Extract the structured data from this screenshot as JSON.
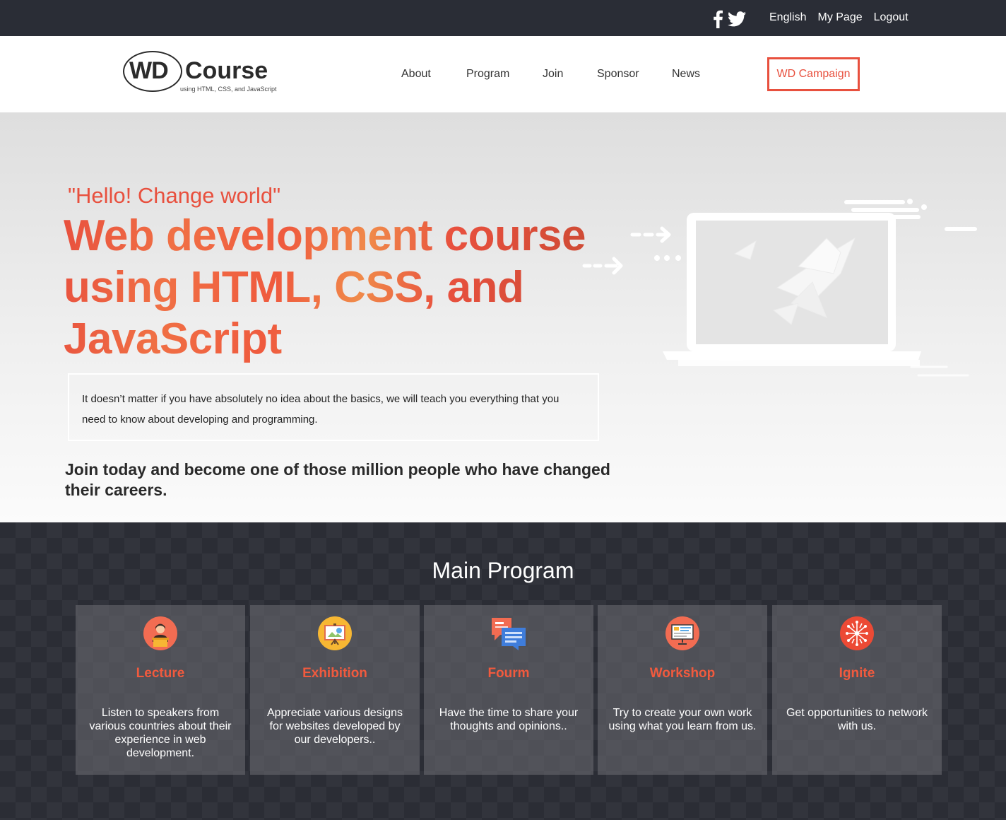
{
  "topbar": {
    "social": [
      {
        "icon": "facebook-icon"
      },
      {
        "icon": "twitter-icon"
      }
    ],
    "links": [
      "English",
      "My Page",
      "Logout"
    ]
  },
  "header": {
    "logo": {
      "mark": "WD",
      "name": "Course",
      "tagline": "using HTML, CSS, and JavaScript"
    },
    "nav": [
      "About",
      "Program",
      "Join",
      "Sponsor",
      "News"
    ],
    "campaign": "WD Campaign"
  },
  "hero": {
    "hello": "\"Hello! Change world\"",
    "title": "Web development course using HTML, CSS, and JavaScript",
    "description": "It doesn’t matter if you have absolutely no idea about the basics, we will teach you everything that you need to know about developing and programming.",
    "join": "Join today and become one of those million people who have changed their careers."
  },
  "program": {
    "heading": "Main Program",
    "cards": [
      {
        "icon": "lecture-icon",
        "title": "Lecture",
        "desc": "Listen to speakers from various countries about their experience in web development."
      },
      {
        "icon": "exhibition-icon",
        "title": "Exhibition",
        "desc": "Appreciate various designs for websites developed by our developers.."
      },
      {
        "icon": "forum-icon",
        "title": "Fourm",
        "desc": "Have the time to share your thoughts and opinions.."
      },
      {
        "icon": "workshop-icon",
        "title": "Workshop",
        "desc": "Try to create your own work using what you learn from us."
      },
      {
        "icon": "ignite-icon",
        "title": "Ignite",
        "desc": "Get opportunities to network with us."
      }
    ]
  },
  "colors": {
    "accent": "#e8503e",
    "topbar": "#2a2d36",
    "program_bg": "#2b2d35"
  }
}
